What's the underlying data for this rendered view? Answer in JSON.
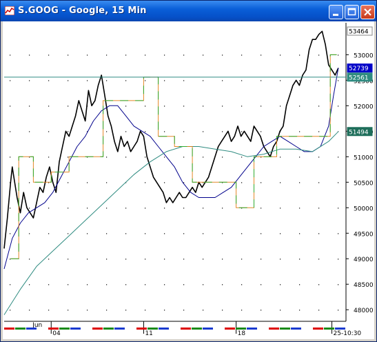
{
  "window": {
    "title": "S.GOOG - Google, 15 Min",
    "buttons": [
      "minimize",
      "maximize",
      "close"
    ],
    "icons": {
      "app": "chart-app-icon",
      "minimize": "minimize-icon",
      "maximize": "maximize-icon",
      "close": "close-icon"
    }
  },
  "chart_data": {
    "type": "line",
    "symbol": "S.GOOG",
    "title": "S.GOOG - Google, 15 Min",
    "interval": "15 Min",
    "ylim": [
      478.0,
      536.0
    ],
    "y_ticks": [
      480,
      485,
      490,
      495,
      500,
      505,
      510,
      515,
      520,
      525,
      530
    ],
    "y_tick_labels": [
      "48000",
      "48500",
      "49000",
      "49500",
      "50000",
      "50500",
      "51000",
      "51500",
      "52000",
      "52500",
      "53000"
    ],
    "x_ticks": [
      {
        "label": "Jun",
        "t": 3.5,
        "row": 1
      },
      {
        "label": "04",
        "t": 5.8,
        "row": 2
      },
      {
        "label": "11",
        "t": 17.2,
        "row": 2
      },
      {
        "label": "18",
        "t": 28.6,
        "row": 2
      },
      {
        "label": "25-10:30",
        "t": 40.4,
        "row": 2
      }
    ],
    "x_range": [
      0,
      41.8
    ],
    "grid": true,
    "value_tags": [
      {
        "label": "53464",
        "value": 534.64,
        "color": "#ffffff",
        "text": "#000000"
      },
      {
        "label": "52739",
        "value": 527.39,
        "color": "#0000c8",
        "text": "#ffffff"
      },
      {
        "label": "52561",
        "value": 525.61,
        "color": "#2e8b80",
        "text": "#ffffff"
      },
      {
        "label": "51494",
        "value": 514.94,
        "color": "#1e6e5a",
        "text": "#ffffff"
      }
    ],
    "horizontal_line": {
      "value": 525.61,
      "color": "#2e8b80"
    },
    "series": [
      {
        "role": "price",
        "color": "#000000",
        "x": [
          0,
          0.4,
          0.8,
          1.0,
          1.2,
          1.6,
          2.0,
          2.4,
          2.8,
          3.2,
          3.6,
          4.0,
          4.4,
          4.8,
          5.2,
          5.6,
          6.0,
          6.4,
          6.8,
          7.2,
          7.6,
          8.0,
          8.4,
          8.8,
          9.2,
          9.6,
          10.0,
          10.4,
          10.8,
          11.2,
          11.6,
          12.0,
          12.4,
          12.8,
          13.2,
          13.6,
          14.0,
          14.4,
          14.8,
          15.2,
          15.6,
          16.0,
          16.4,
          16.8,
          17.2,
          17.6,
          18.0,
          18.4,
          18.8,
          19.2,
          19.6,
          20.0,
          20.4,
          20.8,
          21.2,
          21.6,
          22.0,
          22.4,
          22.8,
          23.2,
          23.6,
          24.0,
          24.4,
          24.8,
          25.2,
          25.6,
          26.0,
          26.4,
          26.8,
          27.2,
          27.6,
          28.0,
          28.4,
          28.8,
          29.2,
          29.6,
          30.0,
          30.4,
          30.8,
          31.2,
          31.6,
          32.0,
          32.4,
          32.8,
          33.2,
          33.6,
          34.0,
          34.4,
          34.8,
          35.2,
          35.6,
          36.0,
          36.4,
          36.8,
          37.2,
          37.6,
          38.0,
          38.4,
          38.8,
          39.2,
          39.6,
          40.0,
          40.4,
          40.8,
          41.2
        ],
        "values": [
          492,
          498,
          505,
          508,
          506,
          502,
          499,
          503,
          500,
          499,
          498,
          501,
          504,
          503,
          506,
          508,
          505,
          503,
          509,
          512,
          515,
          514,
          516,
          518,
          521,
          519,
          517,
          523,
          520,
          521,
          524,
          526,
          522,
          518,
          516,
          513,
          511,
          514,
          512,
          513,
          511,
          512,
          513,
          515,
          514,
          510,
          508,
          506,
          505,
          504,
          503,
          501,
          502,
          501,
          502,
          503,
          502,
          502,
          503,
          504,
          503,
          505,
          504,
          505,
          506,
          508,
          510,
          512,
          513,
          514,
          515,
          513,
          514,
          516,
          514,
          515,
          514,
          513,
          516,
          515,
          514,
          512,
          511,
          510,
          512,
          513,
          515,
          516,
          520,
          522,
          524,
          525,
          524,
          526,
          527,
          531,
          533,
          533,
          534,
          534.6,
          532,
          528,
          527,
          526,
          527.4
        ]
      },
      {
        "role": "moving-average-fast",
        "color": "#00008b",
        "x": [
          0,
          1,
          2,
          3,
          4,
          5,
          6,
          7,
          8,
          9,
          10,
          11,
          12,
          13,
          14,
          15,
          16,
          17,
          18,
          19,
          20,
          21,
          22,
          23,
          24,
          25,
          26,
          27,
          28,
          29,
          30,
          31,
          32,
          33,
          34,
          35,
          36,
          37,
          38,
          39,
          40,
          40.6,
          41.2
        ],
        "values": [
          488,
          494,
          497,
          499,
          500,
          501,
          503,
          506,
          509,
          512,
          514,
          517,
          519,
          520,
          520,
          518,
          516,
          515,
          514,
          512,
          510,
          508,
          505,
          503,
          502,
          502,
          502,
          503,
          504,
          506,
          508,
          510,
          512,
          513,
          514,
          513,
          512,
          511,
          511,
          512,
          516,
          522,
          527.4
        ]
      },
      {
        "role": "moving-average-slow",
        "color": "#2e8b80",
        "x": [
          0,
          2,
          4,
          6,
          8,
          10,
          12,
          14,
          16,
          18,
          20,
          22,
          24,
          26,
          28,
          30,
          32,
          34,
          36,
          38,
          40,
          41.2
        ],
        "values": [
          479,
          484,
          488.5,
          491.5,
          494.5,
          497.5,
          500.5,
          503.5,
          506.5,
          509,
          511,
          512,
          512,
          511.5,
          511,
          510,
          510.5,
          511.5,
          511.5,
          511,
          513,
          514.94
        ]
      },
      {
        "role": "range-bands",
        "color": "#2eaa2e",
        "x": [
          0.8,
          1.8,
          1.8,
          3.6,
          3.6,
          5.8,
          5.8,
          8.0,
          8.0,
          12.2,
          12.2,
          17.2,
          17.2,
          19.0,
          19.0,
          21.0,
          21.0,
          23.2,
          23.2,
          28.6,
          28.6,
          30.8,
          30.8,
          33.6,
          33.6,
          37.0,
          37.0,
          40.2,
          40.2,
          41.0
        ],
        "values": [
          490,
          490,
          510,
          510,
          505,
          505,
          507,
          507,
          510,
          510,
          521,
          521,
          525.6,
          525.6,
          514,
          514,
          512,
          512,
          505,
          505,
          500,
          500,
          510,
          510,
          514,
          514,
          514,
          514,
          530,
          530
        ]
      }
    ],
    "data_labels": [
      "53464",
      "52739",
      "52561",
      "51494"
    ]
  }
}
